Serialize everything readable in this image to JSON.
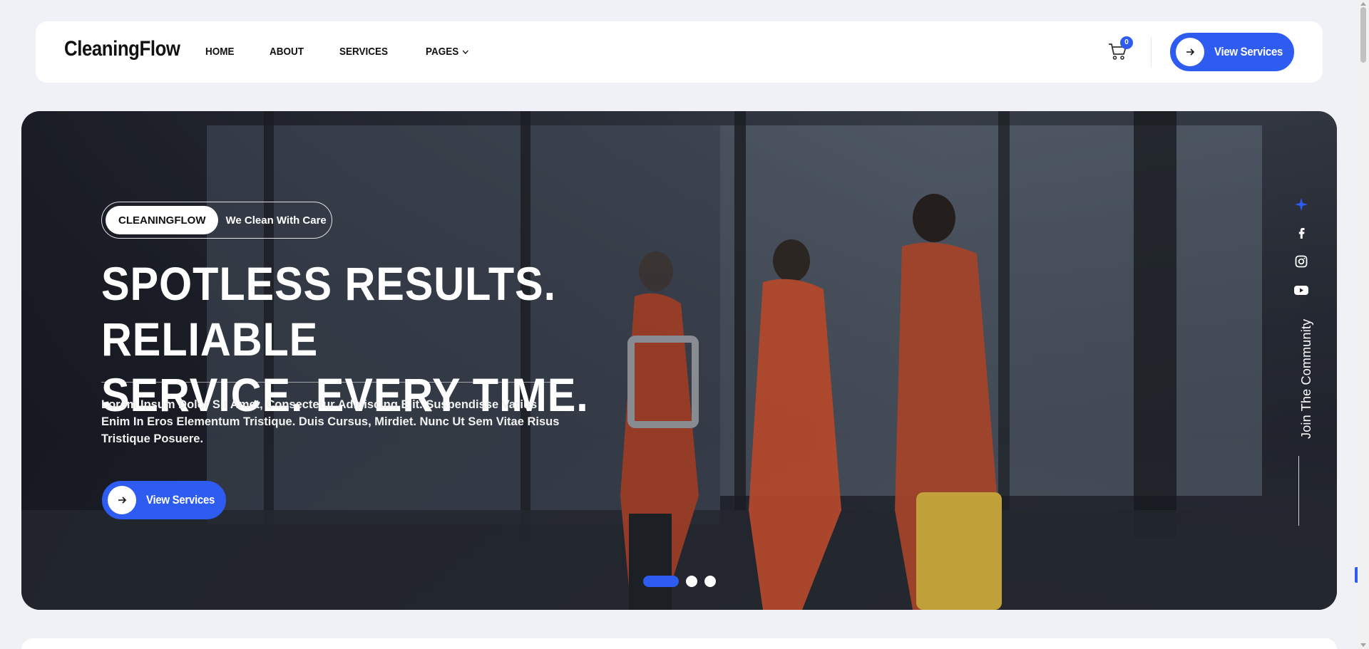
{
  "header": {
    "logo": "CleaningFlow",
    "nav": [
      {
        "label": "HOME"
      },
      {
        "label": "ABOUT"
      },
      {
        "label": "SERVICES"
      },
      {
        "label": "PAGES"
      }
    ],
    "cart_count": "0",
    "cta_label": "View Services"
  },
  "hero": {
    "badge": "CLEANINGFLOW",
    "tagline": "We Clean With Care",
    "title_line1": "SPOTLESS RESULTS. RELIABLE",
    "title_line2": "SERVICE. EVERY TIME.",
    "description": "Lorem Ipsum Dolor Sit Amet, Consectetur Adipiscing Elit. Suspendisse Varius Enim In Eros Elementum Tristique. Duis Cursus, Mirdiet. Nunc Ut Sem Vitae Risus Tristique Posuere.",
    "cta_label": "View Services",
    "slides": {
      "count": 3,
      "active": 1
    },
    "join_label": "Join The Community"
  },
  "colors": {
    "accent": "#2e5bf0",
    "page_bg": "#eff1f6"
  },
  "icons": [
    "cart-icon",
    "arrow-right-icon",
    "chevron-down-icon",
    "star-icon",
    "facebook-icon",
    "instagram-icon",
    "youtube-icon"
  ]
}
